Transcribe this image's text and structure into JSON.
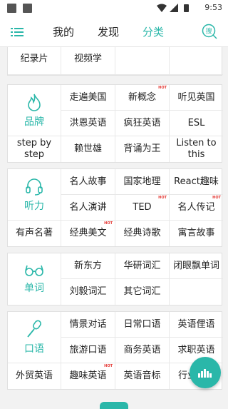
{
  "status": {
    "time": "9:53"
  },
  "header": {
    "tabs": [
      {
        "label": "我的"
      },
      {
        "label": "发现"
      },
      {
        "label": "分类"
      }
    ],
    "search_label": "搜"
  },
  "hot_label": "HOT",
  "sections": [
    {
      "category": "",
      "items": [
        "纪录片",
        "视频学",
        "",
        ""
      ],
      "hot": [
        true,
        true,
        false,
        false
      ]
    },
    {
      "category": "品牌",
      "items": [
        "走遍美国",
        "新概念",
        "听见英国",
        "洪恩英语",
        "疯狂英语",
        "ESL",
        "step by step",
        "赖世雄",
        "背诵为王",
        "Listen to this"
      ],
      "hot": [
        false,
        true,
        false,
        false,
        false,
        false,
        false,
        false,
        false,
        false
      ]
    },
    {
      "category": "听力",
      "items": [
        "名人故事",
        "国家地理",
        "React趣味",
        "名人演讲",
        "TED",
        "名人传记",
        "有声名著",
        "经典美文",
        "经典诗歌",
        "寓言故事"
      ],
      "hot": [
        false,
        false,
        false,
        false,
        true,
        true,
        false,
        true,
        false,
        false
      ]
    },
    {
      "category": "单词",
      "items": [
        "新东方",
        "华研词汇",
        "闭眼飘单词",
        "刘毅词汇",
        "其它词汇",
        ""
      ],
      "hot": [
        false,
        false,
        false,
        false,
        false,
        false
      ]
    },
    {
      "category": "口语",
      "items": [
        "情景对话",
        "日常口语",
        "英语俚语",
        "旅游口语",
        "商务英语",
        "求职英语",
        "外贸英语",
        "趣味英语",
        "英语音标",
        "行业"
      ],
      "hot": [
        false,
        false,
        false,
        false,
        false,
        false,
        false,
        true,
        false,
        false
      ]
    }
  ],
  "colors": {
    "accent": "#2ab7a9",
    "hot": "#e53935"
  }
}
